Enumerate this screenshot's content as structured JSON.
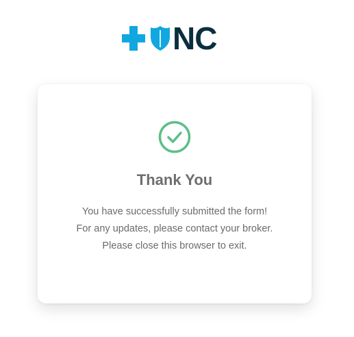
{
  "brand": {
    "logo_text": "NC",
    "colors": {
      "cross": "#11a7e0",
      "shield": "#11a7e0",
      "text": "#0b2e3f"
    }
  },
  "card": {
    "icon": "check-circle-icon",
    "icon_color": "#5cbf87",
    "title": "Thank You",
    "messages": [
      "You have successfully submitted the form!",
      "For any updates, please contact your broker.",
      "Please close this browser to exit."
    ]
  }
}
